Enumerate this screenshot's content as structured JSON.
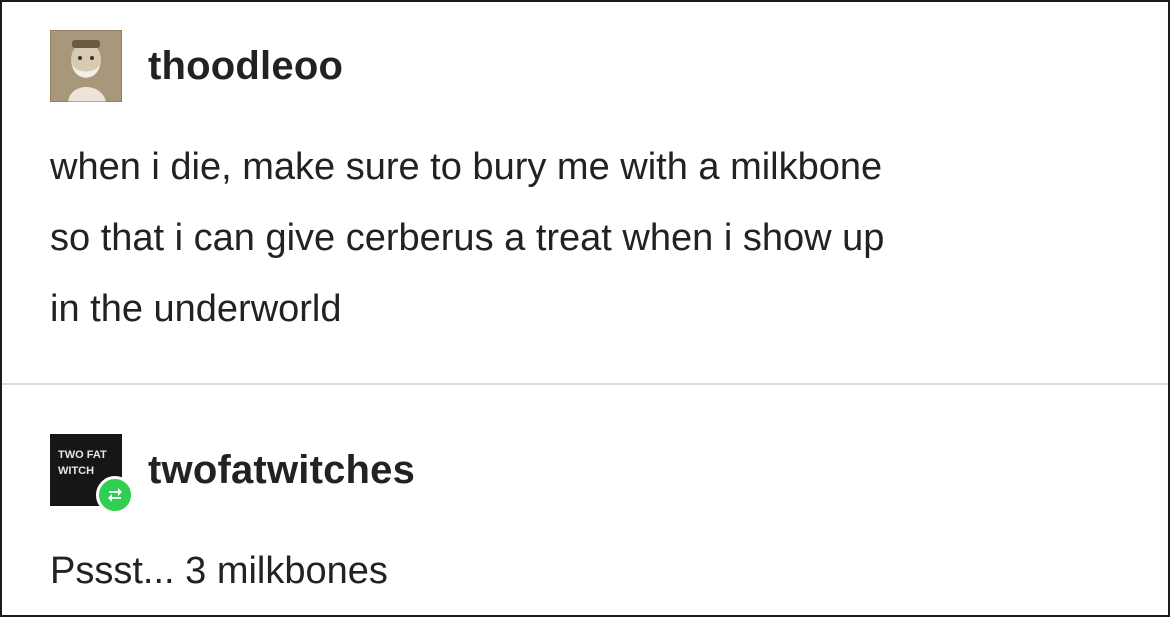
{
  "posts": [
    {
      "username": "thoodleoo",
      "avatar_icon": "portrait-avatar-icon",
      "body_lines": [
        "when i die, make sure to bury me with a milkbone",
        "so that i can give cerberus a treat when i show up",
        "in the underworld"
      ]
    },
    {
      "username": "twofatwitches",
      "avatar_icon": "logo-avatar-icon",
      "avatar_text": [
        "TWO FAT",
        "WITCH"
      ],
      "badge_icon": "reblog-icon",
      "badge_color": "#2fcf4f",
      "body_lines": [
        "Pssst... 3 milkbones"
      ]
    }
  ],
  "colors": {
    "text": "#222222",
    "divider": "#d9d9d9",
    "border": "#1a1a1a"
  }
}
